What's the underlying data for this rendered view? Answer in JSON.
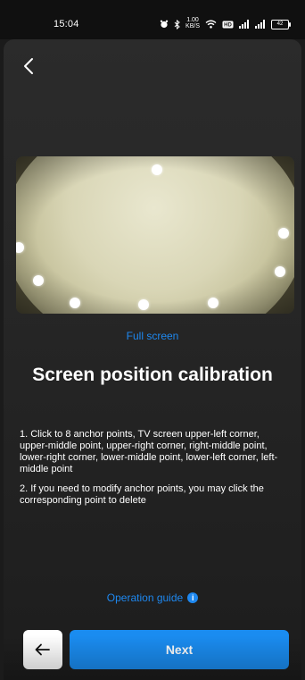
{
  "status_bar": {
    "time": "15:04",
    "net_speed": "1.00\nKB/S",
    "battery": "42",
    "icons": [
      "alarm-icon",
      "bluetooth-icon",
      "net-speed",
      "wifi-icon",
      "hd-icon",
      "signal-icon",
      "signal-icon",
      "battery-icon"
    ]
  },
  "header": {
    "back_icon": "‹"
  },
  "preview": {
    "image_description": "fisheye camera view of TV screen with 8 white anchor points",
    "full_screen_label": "Full screen"
  },
  "title": "Screen position calibration",
  "instructions": [
    "1. Click to 8 anchor points, TV screen upper-left corner, upper-middle point, upper-right corner, right-middle point, lower-right corner, lower-middle point, lower-left corner, left-middle point",
    "2. If you need to modify anchor points, you may click the corresponding point to delete"
  ],
  "operation_guide_label": "Operation guide",
  "footer": {
    "prev_icon": "←",
    "next_label": "Next"
  },
  "colors": {
    "accent": "#1a8cf0",
    "background": "#262626"
  }
}
